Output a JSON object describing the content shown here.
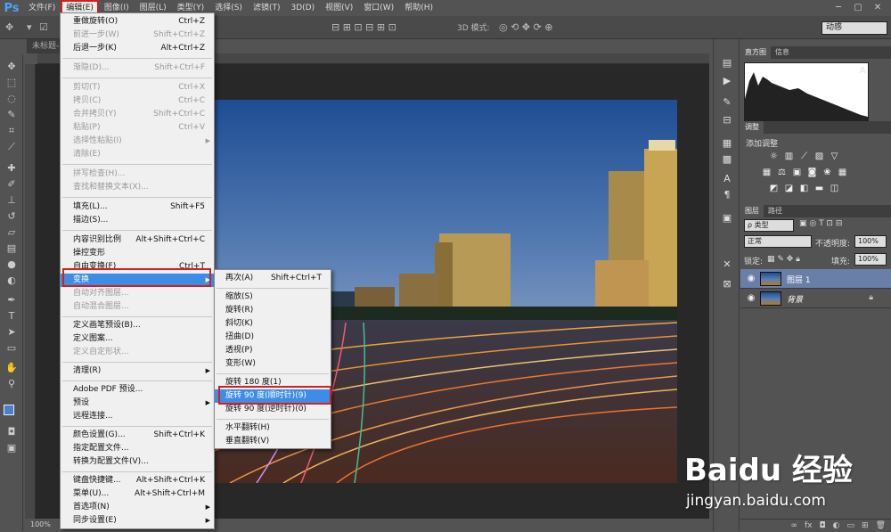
{
  "app": {
    "logo": "Ps"
  },
  "menubar": [
    "文件(F)",
    "编辑(E)",
    "图像(I)",
    "图层(L)",
    "类型(Y)",
    "选择(S)",
    "滤镜(T)",
    "3D(D)",
    "视图(V)",
    "窗口(W)",
    "帮助(H)"
  ],
  "options": {
    "mode_label": "3D 模式:",
    "workspace": "动感"
  },
  "document": {
    "tab": "未标题-",
    "zoom": "100%"
  },
  "edit_menu": [
    {
      "label": "重做旋转(O)",
      "sc": "Ctrl+Z"
    },
    {
      "label": "前进一步(W)",
      "sc": "Shift+Ctrl+Z"
    },
    {
      "label": "后退一步(K)",
      "sc": "Alt+Ctrl+Z"
    },
    {
      "label": "渐隐(D)...",
      "sc": "Shift+Ctrl+F"
    },
    {
      "label": "剪切(T)",
      "sc": "Ctrl+X"
    },
    {
      "label": "拷贝(C)",
      "sc": "Ctrl+C"
    },
    {
      "label": "合并拷贝(Y)",
      "sc": "Shift+Ctrl+C"
    },
    {
      "label": "粘贴(P)",
      "sc": "Ctrl+V"
    },
    {
      "label": "选择性粘贴(I)",
      "sc": ""
    },
    {
      "label": "清除(E)",
      "sc": ""
    },
    {
      "label": "拼写检查(H)...",
      "sc": ""
    },
    {
      "label": "查找和替换文本(X)...",
      "sc": ""
    },
    {
      "label": "填充(L)...",
      "sc": "Shift+F5"
    },
    {
      "label": "描边(S)...",
      "sc": ""
    },
    {
      "label": "内容识别比例",
      "sc": "Alt+Shift+Ctrl+C"
    },
    {
      "label": "操控变形",
      "sc": ""
    },
    {
      "label": "自由变换(F)",
      "sc": "Ctrl+T"
    },
    {
      "label": "变换",
      "sc": ""
    },
    {
      "label": "自动对齐图层...",
      "sc": ""
    },
    {
      "label": "自动混合图层...",
      "sc": ""
    },
    {
      "label": "定义画笔预设(B)...",
      "sc": ""
    },
    {
      "label": "定义图案...",
      "sc": ""
    },
    {
      "label": "定义自定形状...",
      "sc": ""
    },
    {
      "label": "清理(R)",
      "sc": ""
    },
    {
      "label": "Adobe PDF 预设...",
      "sc": ""
    },
    {
      "label": "预设",
      "sc": ""
    },
    {
      "label": "远程连接...",
      "sc": ""
    },
    {
      "label": "颜色设置(G)...",
      "sc": "Shift+Ctrl+K"
    },
    {
      "label": "指定配置文件...",
      "sc": ""
    },
    {
      "label": "转换为配置文件(V)...",
      "sc": ""
    },
    {
      "label": "键盘快捷键...",
      "sc": "Alt+Shift+Ctrl+K"
    },
    {
      "label": "菜单(U)...",
      "sc": "Alt+Shift+Ctrl+M"
    },
    {
      "label": "首选项(N)",
      "sc": ""
    },
    {
      "label": "同步设置(E)",
      "sc": ""
    }
  ],
  "transform_menu": [
    {
      "label": "再次(A)",
      "sc": "Shift+Ctrl+T"
    },
    {
      "label": "缩放(S)",
      "sc": ""
    },
    {
      "label": "旋转(R)",
      "sc": ""
    },
    {
      "label": "斜切(K)",
      "sc": ""
    },
    {
      "label": "扭曲(D)",
      "sc": ""
    },
    {
      "label": "透视(P)",
      "sc": ""
    },
    {
      "label": "变形(W)",
      "sc": ""
    },
    {
      "label": "旋转 180 度(1)",
      "sc": ""
    },
    {
      "label": "旋转 90 度(顺时针)(9)",
      "sc": ""
    },
    {
      "label": "旋转 90 度(逆时针)(0)",
      "sc": ""
    },
    {
      "label": "水平翻转(H)",
      "sc": ""
    },
    {
      "label": "垂直翻转(V)",
      "sc": ""
    }
  ],
  "panels": {
    "histogram_tabs": [
      "直方图",
      "信息"
    ],
    "adjust_tab": "调整",
    "adjust_label": "添加调整",
    "layers_tabs": [
      "图层",
      "路径"
    ],
    "kind_filter": "ρ 类型",
    "blend_mode": "正常",
    "opacity_label": "不透明度:",
    "opacity_value": "100%",
    "lock_label": "锁定:",
    "fill_label": "填充:",
    "fill_value": "100%",
    "layers": [
      {
        "name": "图层 1",
        "selected": true
      },
      {
        "name": "背景",
        "selected": false
      }
    ]
  },
  "watermark": {
    "logo": "Baidu 经验",
    "url": "jingyan.baidu.com"
  },
  "colors": {
    "highlight": "#3d8ce6",
    "redbox": "#d41f1f"
  }
}
